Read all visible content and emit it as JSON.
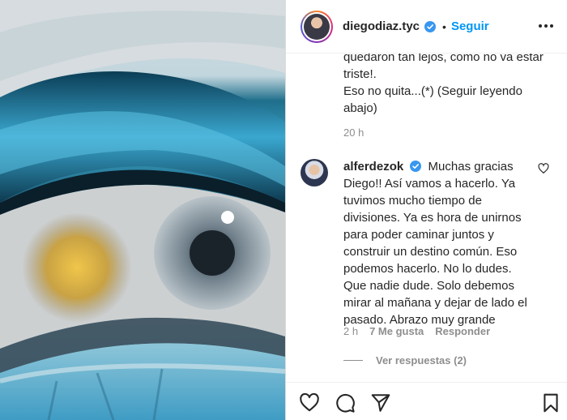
{
  "header": {
    "username": "diegodiaz.tyc",
    "separator": "•",
    "follow_label": "Seguir"
  },
  "caption": {
    "lines": [
      "quedaron tan lejos, como no va estar",
      "triste!.",
      "Eso no quita...(*) (Seguir leyendo",
      "abajo)"
    ],
    "time": "20 h"
  },
  "reply": {
    "username": "alferdezok",
    "text": "Muchas gracias Diego!! Así vamos a hacerlo. Ya tuvimos mucho tiempo de divisiones. Ya es hora de unirnos para poder caminar juntos y construir un destino común. Eso podemos hacerlo. No lo dudes. Que nadie dude. Solo debemos mirar al mañana y dejar de lado el pasado. Abrazo muy grande",
    "time": "2 h",
    "likes": "7 Me gusta",
    "reply_label": "Responder",
    "view_replies": "Ver respuestas (2)"
  },
  "colors": {
    "accent": "#0095f6",
    "verified": "#3897f0",
    "muted": "#8e8e8e",
    "text": "#262626"
  },
  "icons": [
    "verified-badge-icon",
    "more-options-icon",
    "heart-icon",
    "comment-icon",
    "share-icon",
    "save-icon"
  ]
}
